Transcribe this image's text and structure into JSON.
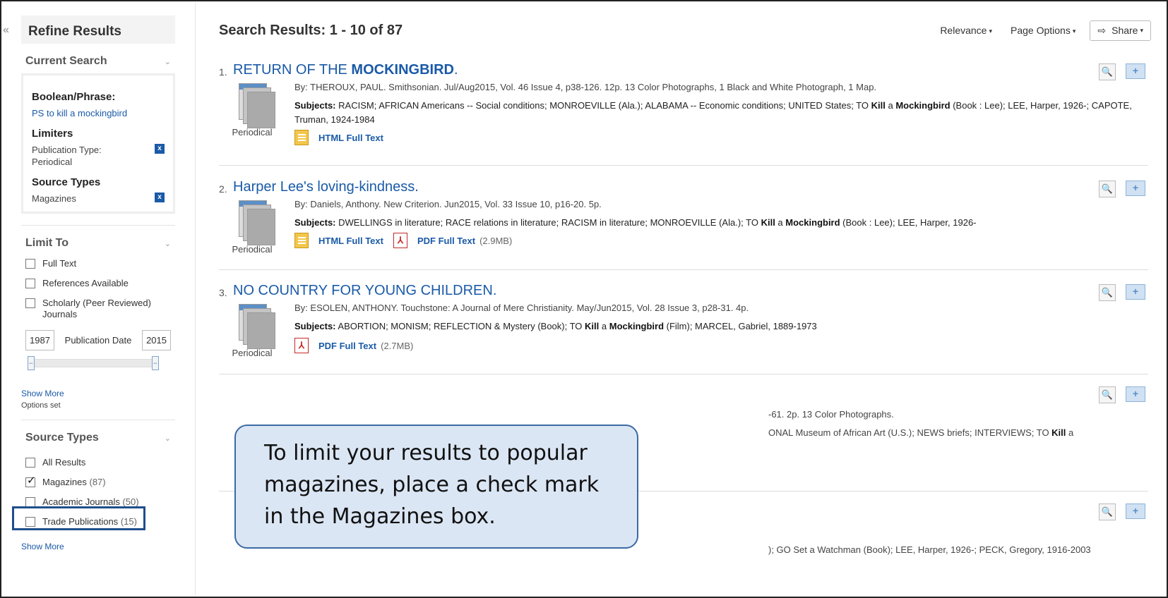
{
  "sidebar": {
    "collapse": "«",
    "refine_title": "Refine Results",
    "current_search": {
      "title": "Current Search",
      "boolean_label": "Boolean/Phrase:",
      "boolean_value": "PS to kill a mockingbird",
      "limiters_label": "Limiters",
      "limiter_value": "Publication Type: Periodical",
      "source_types_label": "Source Types",
      "source_value": "Magazines",
      "remove": "x"
    },
    "limit_to": {
      "title": "Limit To",
      "options": [
        {
          "label": "Full Text",
          "checked": false
        },
        {
          "label": "References Available",
          "checked": false
        },
        {
          "label": "Scholarly (Peer Reviewed) Journals",
          "checked": false
        }
      ],
      "date_from": "1987",
      "date_label": "Publication Date",
      "date_to": "2015",
      "slider_handle": "⇔",
      "show_more": "Show More",
      "options_set": "Options set"
    },
    "source_types": {
      "title": "Source Types",
      "options": [
        {
          "label": "All Results",
          "count": "",
          "checked": false
        },
        {
          "label": "Magazines",
          "count": "(87)",
          "checked": true
        },
        {
          "label": "Academic Journals",
          "count": "(50)",
          "checked": false
        },
        {
          "label": "Trade Publications",
          "count": "(15)",
          "checked": false
        }
      ],
      "show_more": "Show More"
    }
  },
  "toolbar": {
    "results_title": "Search Results: 1 - 10 of 87",
    "relevance": "Relevance",
    "page_options": "Page Options",
    "share": "Share",
    "caret": "▾",
    "share_icon": "⇨"
  },
  "results": [
    {
      "num": "1.",
      "title_prefix": "RETURN OF THE ",
      "title_bold": "MOCKINGBIRD",
      "title_suffix": ".",
      "pub_type": "Periodical",
      "meta": "By: THEROUX, PAUL. Smithsonian. Jul/Aug2015, Vol. 46 Issue 4, p38-126. 12p. 13 Color Photographs, 1 Black and White Photograph, 1 Map.",
      "subjects_label": "Subjects:",
      "subjects_a": "RACISM; AFRICAN Americans -- Social conditions; MONROEVILLE (Ala.); ALABAMA -- Economic conditions; UNITED States; TO ",
      "subjects_kill": "Kill",
      "subjects_b": " a ",
      "subjects_mock": "Mockingbird",
      "subjects_c": " (Book : Lee); LEE, Harper, 1926-; CAPOTE, Truman, 1924-1984",
      "html_link": "HTML Full Text"
    },
    {
      "num": "2.",
      "title": "Harper Lee's loving-kindness.",
      "pub_type": "Periodical",
      "meta": "By: Daniels, Anthony. New Criterion. Jun2015, Vol. 33 Issue 10, p16-20. 5p.",
      "subjects_label": "Subjects:",
      "subjects_a": "DWELLINGS in literature; RACE relations in literature; RACISM in literature; MONROEVILLE (Ala.); TO ",
      "subjects_kill": "Kill",
      "subjects_b": " a ",
      "subjects_mock": "Mockingbird",
      "subjects_c": " (Book : Lee); LEE, Harper, 1926-",
      "html_link": "HTML Full Text",
      "pdf_link": "PDF Full Text",
      "pdf_size": "(2.9MB)"
    },
    {
      "num": "3.",
      "title": "NO COUNTRY FOR YOUNG CHILDREN.",
      "pub_type": "Periodical",
      "meta": "By: ESOLEN, ANTHONY. Touchstone: A Journal of Mere Christianity. May/Jun2015, Vol. 28 Issue 3, p28-31. 4p.",
      "subjects_label": "Subjects:",
      "subjects_a": "ABORTION; MONISM; REFLECTION & Mystery (Book); TO ",
      "subjects_kill": "Kill",
      "subjects_b": " a ",
      "subjects_mock": "Mockingbird",
      "subjects_c": " (Film); MARCEL, Gabriel, 1889-1973",
      "pdf_link": "PDF Full Text",
      "pdf_size": "(2.7MB)"
    }
  ],
  "partial": {
    "r4_meta": "-61. 2p. 13 Color Photographs.",
    "r4_subjects": "ONAL Museum of African Art (U.S.); NEWS briefs; INTERVIEWS; TO ",
    "r4_kill": "Kill",
    "r4_tail": " a",
    "r5_subjects": "); GO Set a Watchman (Book); LEE, Harper, 1926-; PECK, Gregory, 1916-2003"
  },
  "icons": {
    "preview": "🔍",
    "folder_add": "+",
    "pdf": "⅄",
    "check": "✓"
  },
  "callout": {
    "text": "To limit your results to popular magazines, place a check mark in the Magazines box."
  }
}
